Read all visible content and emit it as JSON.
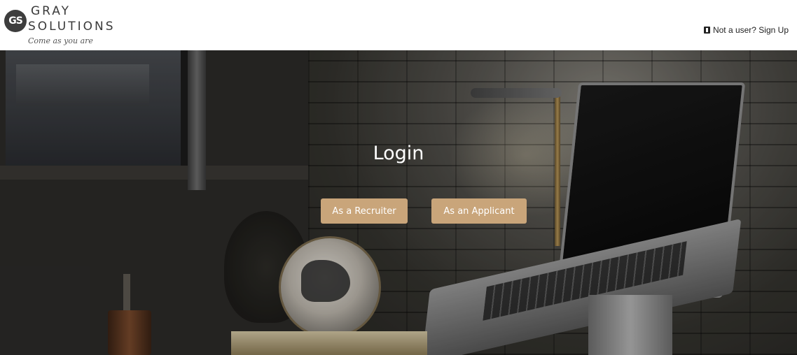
{
  "header": {
    "logo": {
      "badge_text": "GS",
      "line1": "GRAY",
      "line2": "SOLUTIONS",
      "tagline": "Come as you are"
    },
    "signup": {
      "icon": "user-icon",
      "label": "Not a user? Sign Up"
    }
  },
  "hero": {
    "title": "Login",
    "buttons": {
      "recruiter": "As a Recruiter",
      "applicant": "As an Applicant"
    }
  },
  "colors": {
    "accent": "#c9a57a",
    "header_bg": "#ffffff",
    "text_dark": "#222222"
  }
}
